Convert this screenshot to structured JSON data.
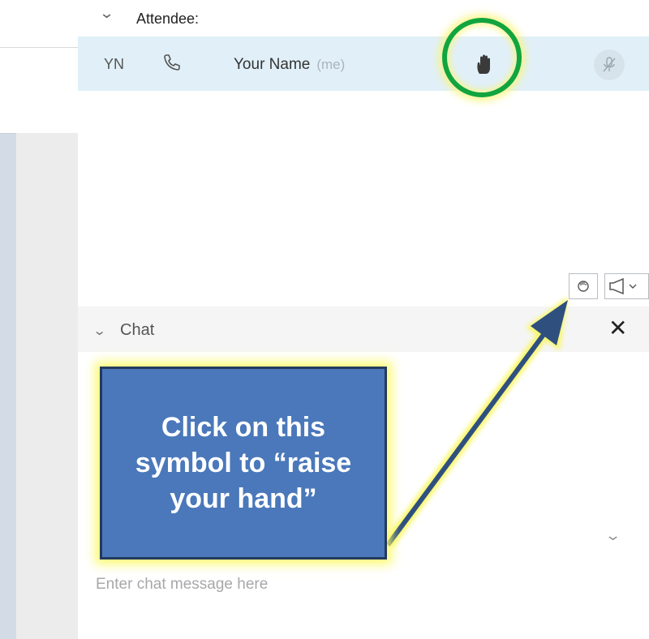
{
  "attendees": {
    "header_label": "Attendee:",
    "row": {
      "initials": "YN",
      "name": "Your Name",
      "me_label": "(me)"
    }
  },
  "chat": {
    "header_label": "Chat",
    "close_label": "✕",
    "input_placeholder": "Enter chat message here"
  },
  "callout": {
    "text": "Click on this symbol to “raise your hand”"
  },
  "colors": {
    "highlight_ring": "#11a43f",
    "callout_fill": "#4a78ba",
    "callout_glow": "#fcfa6e",
    "attendee_row": "#e1f0f8"
  },
  "icons": [
    "phone-icon",
    "raise-hand-icon",
    "microphone-icon",
    "hand-icon",
    "megaphone-icon",
    "chevron-down-icon",
    "close-icon"
  ]
}
